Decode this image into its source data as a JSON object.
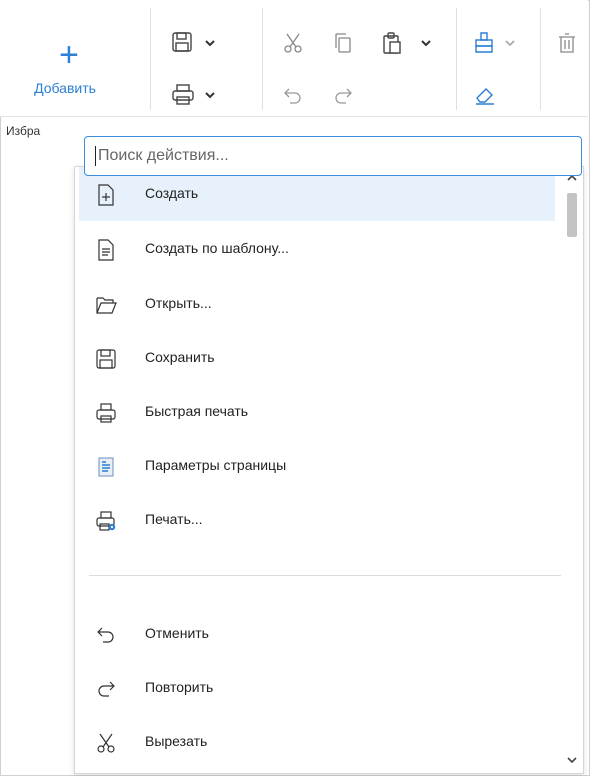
{
  "toolbar": {
    "add_label": "Добавить"
  },
  "favorites": {
    "label": "Избра"
  },
  "search": {
    "placeholder": "Поиск действия..."
  },
  "menu": {
    "items": [
      {
        "label": "Создать",
        "icon": "new-file-icon"
      },
      {
        "label": "Создать по шаблону...",
        "icon": "template-icon"
      },
      {
        "label": "Открыть...",
        "icon": "folder-open-icon"
      },
      {
        "label": "Сохранить",
        "icon": "save-icon"
      },
      {
        "label": "Быстрая печать",
        "icon": "printer-icon"
      },
      {
        "label": "Параметры страницы",
        "icon": "page-setup-icon"
      },
      {
        "label": "Печать...",
        "icon": "print-settings-icon"
      },
      {
        "label": "Отменить",
        "icon": "undo-icon"
      },
      {
        "label": "Повторить",
        "icon": "redo-icon"
      },
      {
        "label": "Вырезать",
        "icon": "cut-icon"
      }
    ],
    "selected_index": 0
  },
  "colors": {
    "accent": "#2b7fd4",
    "selection": "#e6f1fb",
    "border_focus": "#3b8ee0"
  }
}
